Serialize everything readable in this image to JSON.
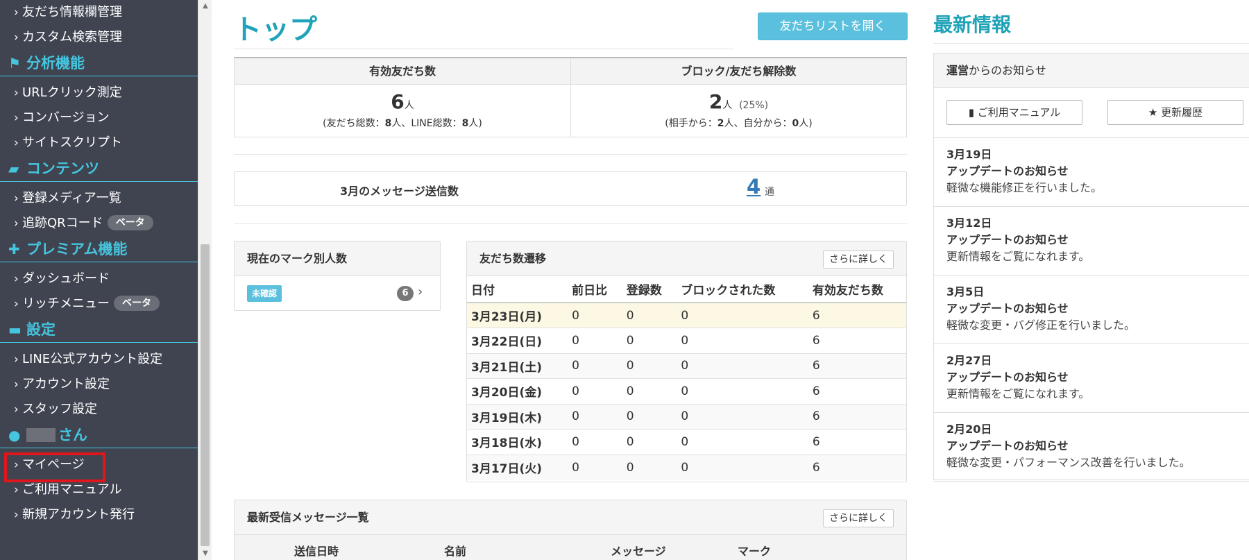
{
  "sidebar": {
    "items": [
      {
        "type": "sub",
        "label": "友だち情報欄管理"
      },
      {
        "type": "sub",
        "label": "カスタム検索管理"
      },
      {
        "type": "head",
        "icon": "flag-icon",
        "label": "分析機能"
      },
      {
        "type": "sub",
        "label": "URLクリック測定"
      },
      {
        "type": "sub",
        "label": "コンバージョン"
      },
      {
        "type": "sub",
        "label": "サイトスクリプト"
      },
      {
        "type": "head",
        "icon": "folder-icon",
        "label": "コンテンツ"
      },
      {
        "type": "sub",
        "label": "登録メディア一覧"
      },
      {
        "type": "sub",
        "label": "追跡QRコード",
        "badge": "ベータ"
      },
      {
        "type": "head",
        "icon": "gift-icon",
        "label": "プレミアム機能"
      },
      {
        "type": "sub",
        "label": "ダッシュボード"
      },
      {
        "type": "sub",
        "label": "リッチメニュー",
        "badge": "ベータ"
      },
      {
        "type": "head",
        "icon": "comment-icon",
        "label": "設定"
      },
      {
        "type": "sub",
        "label": "LINE公式アカウント設定"
      },
      {
        "type": "sub",
        "label": "アカウント設定"
      },
      {
        "type": "sub",
        "label": "スタッフ設定"
      },
      {
        "type": "head",
        "icon": "user-icon",
        "label": "さん",
        "redacted": true
      },
      {
        "type": "sub",
        "label": "マイページ"
      },
      {
        "type": "sub",
        "label": "ご利用マニュアル"
      },
      {
        "type": "sub",
        "label": "新規アカウント発行"
      }
    ]
  },
  "main": {
    "title": "トップ",
    "friends_list_button": "友だちリストを開く",
    "stats": {
      "valid": {
        "label": "有効友だち数",
        "value": "6",
        "unit": "人",
        "sub_prefix": "(友だち総数：",
        "total": "8",
        "sub_mid": "人、LINE総数：",
        "line": "8",
        "sub_suffix": "人)"
      },
      "blocked": {
        "label": "ブロック/友だち解除数",
        "value": "2",
        "unit": "人",
        "pct": "(25%)",
        "sub_prefix": "(相手から：",
        "from_other": "2",
        "sub_mid": "人、自分から：",
        "from_self": "0",
        "sub_suffix": "人)"
      }
    },
    "message_count": {
      "label": "3月のメッセージ送信数",
      "value": "4",
      "unit": "通"
    },
    "marks_panel": {
      "title": "現在のマーク別人数",
      "badge": "未確認",
      "count": "6"
    },
    "friends_panel": {
      "title": "友だち数遷移",
      "more": "さらに詳しく",
      "columns": [
        "日付",
        "前日比",
        "登録数",
        "ブロックされた数",
        "有効友だち数"
      ],
      "rows": [
        [
          "3月23日(月)",
          "0",
          "0",
          "0",
          "6"
        ],
        [
          "3月22日(日)",
          "0",
          "0",
          "0",
          "6"
        ],
        [
          "3月21日(土)",
          "0",
          "0",
          "0",
          "6"
        ],
        [
          "3月20日(金)",
          "0",
          "0",
          "0",
          "6"
        ],
        [
          "3月19日(木)",
          "0",
          "0",
          "0",
          "6"
        ],
        [
          "3月18日(水)",
          "0",
          "0",
          "0",
          "6"
        ],
        [
          "3月17日(火)",
          "0",
          "0",
          "0",
          "6"
        ]
      ]
    },
    "messages_panel": {
      "title": "最新受信メッセージ一覧",
      "more": "さらに詳しく",
      "columns": [
        "送信日時",
        "名前",
        "メッセージ",
        "マーク"
      ]
    }
  },
  "news": {
    "title": "最新情報",
    "header_bold": "運営",
    "header_rest": "からのお知らせ",
    "manual_button": "ご利用マニュアル",
    "history_button": "★ 更新履歴",
    "items": [
      {
        "date": "3月19日",
        "title": "アップデートのお知らせ",
        "body": "軽微な機能修正を行いました。"
      },
      {
        "date": "3月12日",
        "title": "アップデートのお知らせ",
        "body": "更新情報をご覧になれます。"
      },
      {
        "date": "3月5日",
        "title": "アップデートのお知らせ",
        "body": "軽微な変更・バグ修正を行いました。"
      },
      {
        "date": "2月27日",
        "title": "アップデートのお知らせ",
        "body": "更新情報をご覧になれます。"
      },
      {
        "date": "2月20日",
        "title": "アップデートのお知らせ",
        "body": "軽微な変更・パフォーマンス改善を行いました。"
      }
    ]
  }
}
